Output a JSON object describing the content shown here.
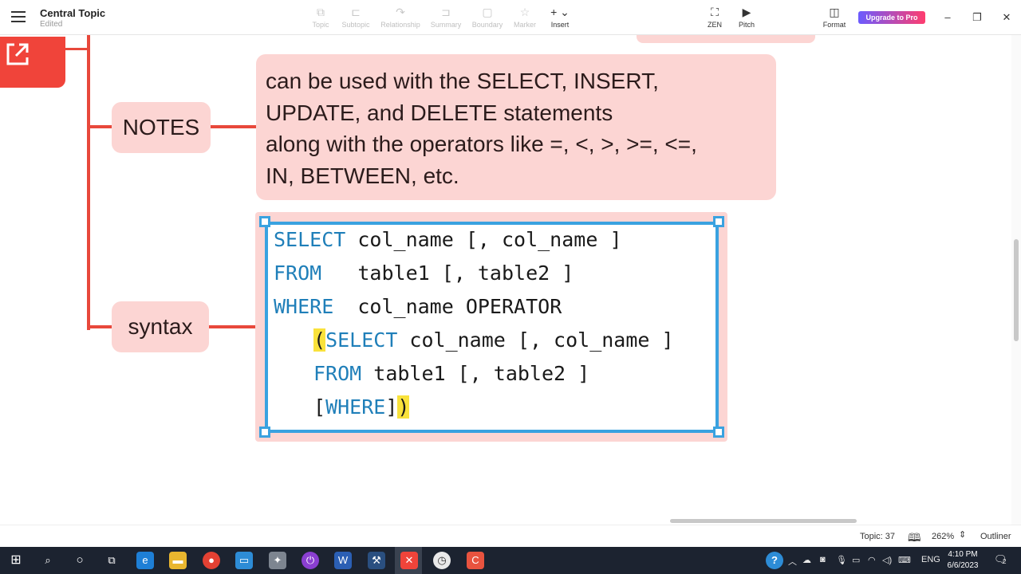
{
  "header": {
    "title": "Central Topic",
    "status": "Edited",
    "tools": [
      {
        "label": "Topic",
        "icon": "topic-icon"
      },
      {
        "label": "Subtopic",
        "icon": "subtopic-icon"
      },
      {
        "label": "Relationship",
        "icon": "relationship-icon"
      },
      {
        "label": "Summary",
        "icon": "summary-icon"
      },
      {
        "label": "Boundary",
        "icon": "boundary-icon"
      },
      {
        "label": "Marker",
        "icon": "star-icon"
      },
      {
        "label": "Insert",
        "icon": "plus-icon"
      }
    ],
    "zen_label": "ZEN",
    "pitch_label": "Pitch",
    "format_label": "Format",
    "upgrade_label": "Upgrade to Pro"
  },
  "mindmap": {
    "notes_label": "NOTES",
    "notes_lines": [
      "can be used with the SELECT, INSERT,",
      "UPDATE, and DELETE statements",
      "along with the operators like =, <, >, >=, <=,",
      "IN, BETWEEN, etc."
    ],
    "syntax_label": "syntax",
    "code": {
      "l1_kw": "SELECT",
      "l1_rest": " col_name [, col_name ]",
      "l2_kw": "FROM",
      "l2_rest": "   table1 [, table2 ]",
      "l3_kw": "WHERE",
      "l3_rest": "  col_name OPERATOR",
      "l4_open": "(",
      "l4_kw": "SELECT",
      "l4_rest": " col_name [, col_name ]",
      "l5_kw": "FROM",
      "l5_rest": " table1 [, table2 ]",
      "l6_open": "[",
      "l6_kw": "WHERE",
      "l6_close": "]",
      "l6_paren": ")"
    }
  },
  "statusbar": {
    "topic_count": "Topic: 37",
    "zoom": "262%",
    "outliner_label": "Outliner"
  },
  "taskbar": {
    "lang": "ENG",
    "time": "4:10 PM",
    "date": "6/6/2023",
    "notification_count": "2"
  },
  "colors": {
    "branch": "#e8483b",
    "node_fill": "#fcd5d3",
    "selection": "#3aa2e0",
    "keyword": "#1f7fb9",
    "highlight": "#f9e23b"
  }
}
